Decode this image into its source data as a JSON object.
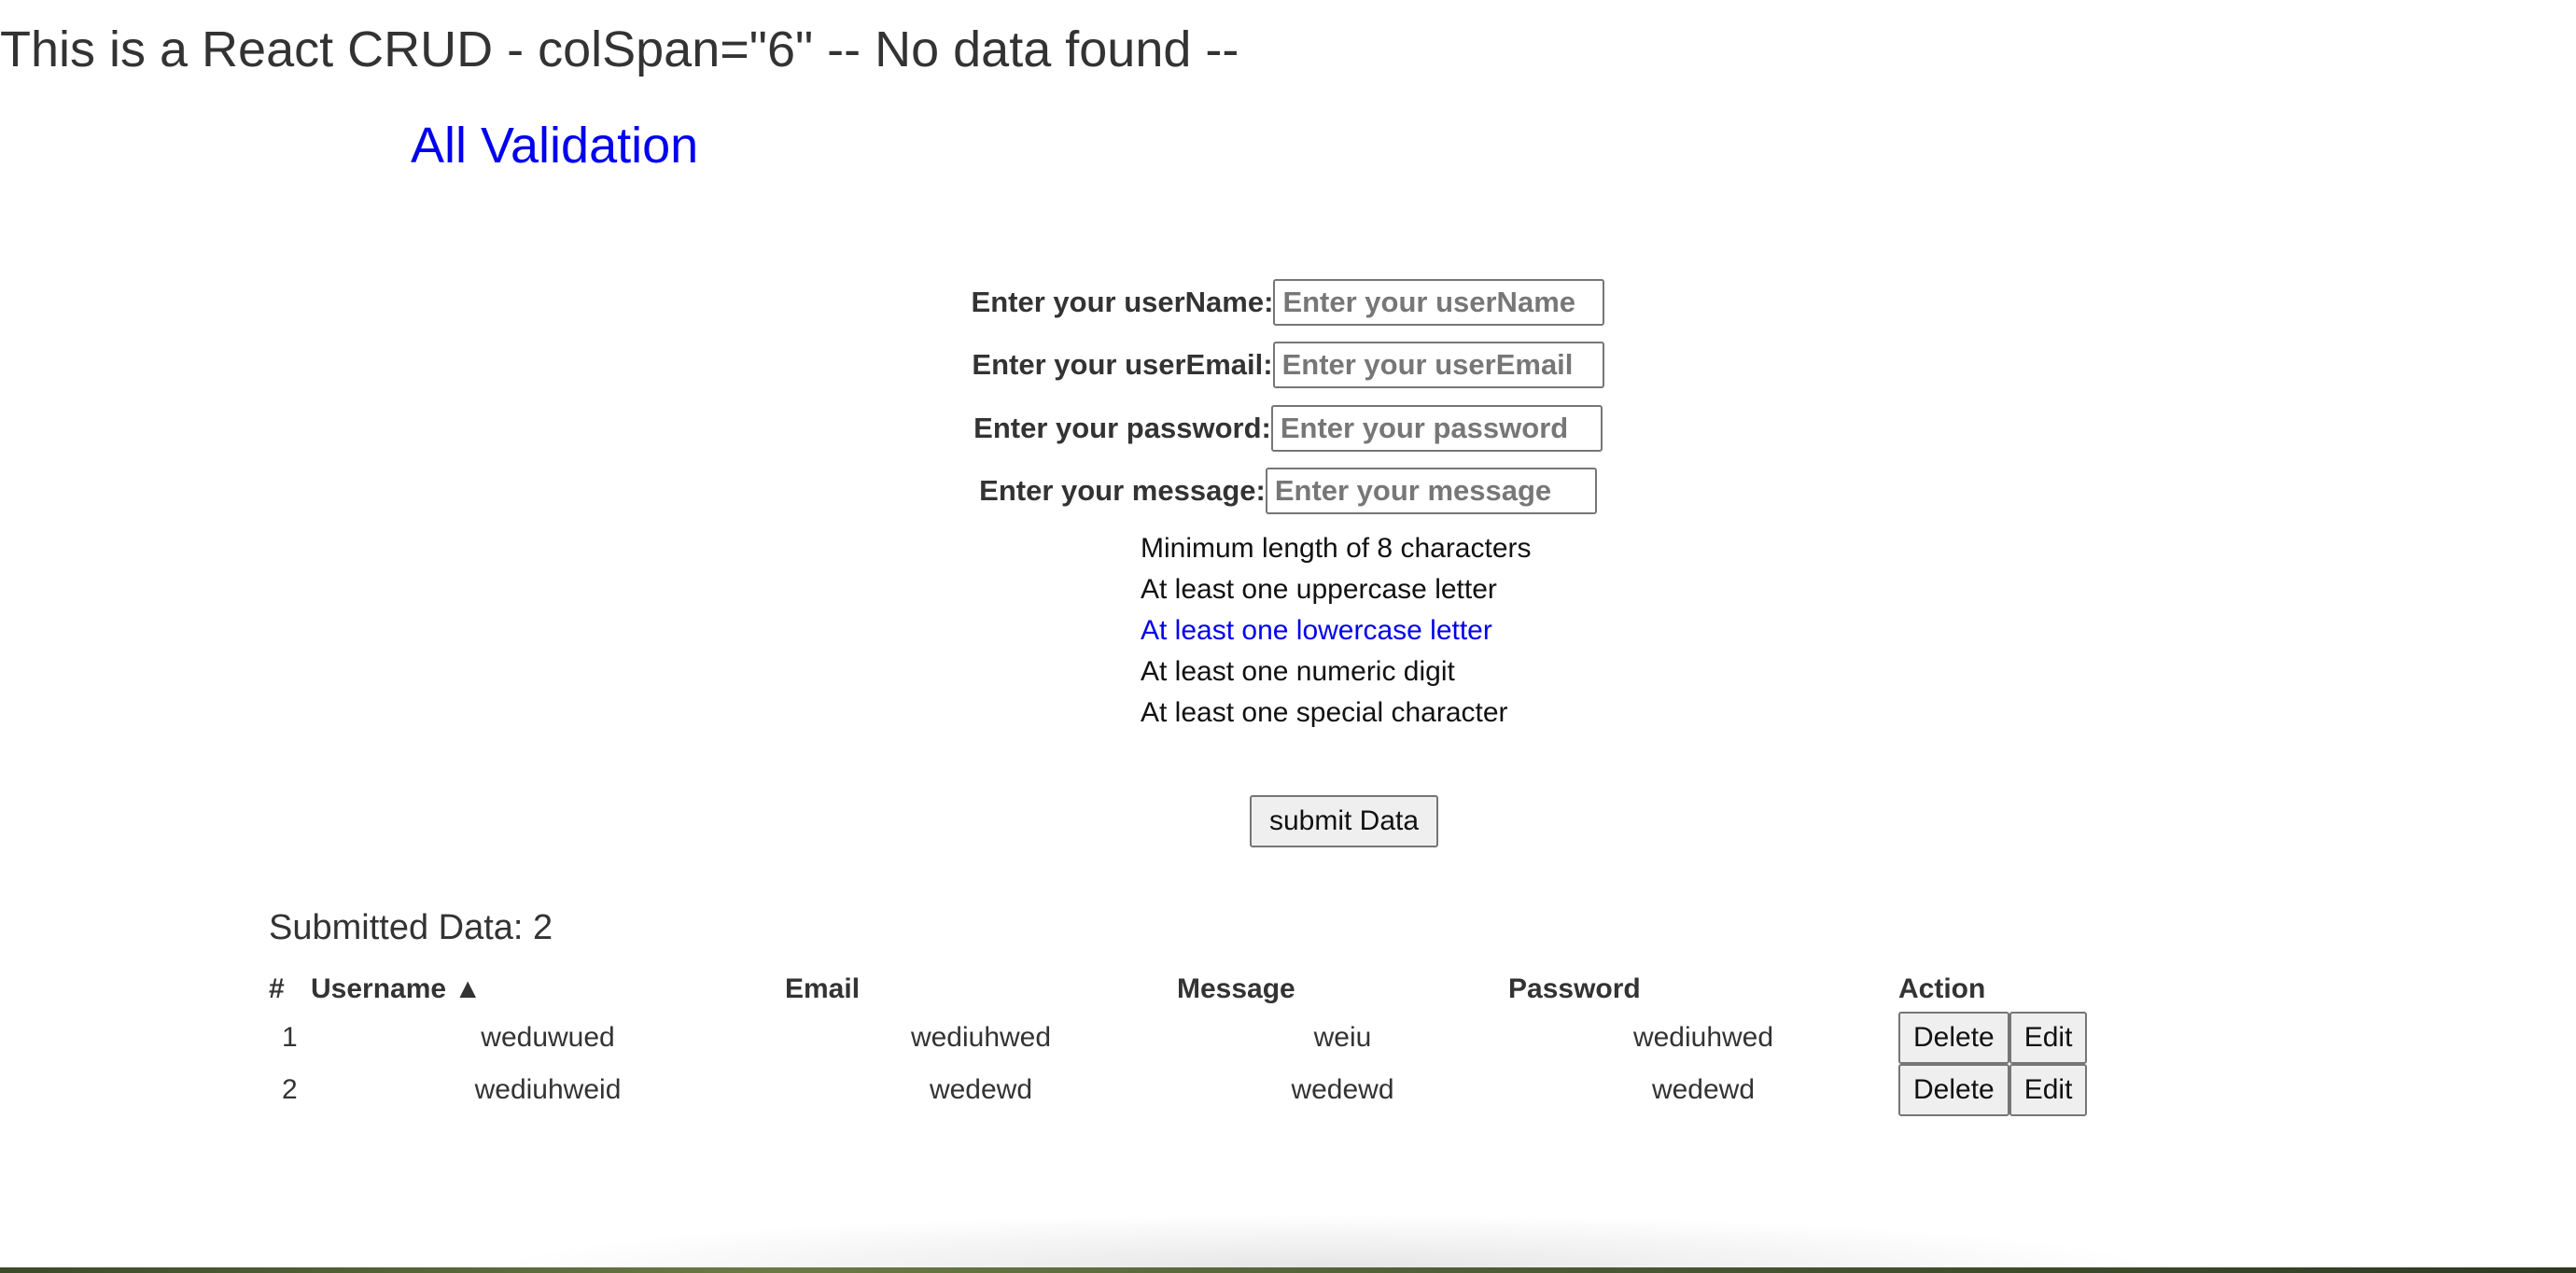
{
  "header": {
    "title": "This is a React CRUD - colSpan=\"6\" -- No data found --",
    "section_title": "All Validation"
  },
  "form": {
    "fields": [
      {
        "label": "Enter your userName:",
        "placeholder": "Enter your userName",
        "type": "text",
        "value": ""
      },
      {
        "label": "Enter your userEmail:",
        "placeholder": "Enter your userEmail",
        "type": "email",
        "value": ""
      },
      {
        "label": "Enter your password:",
        "placeholder": "Enter your password",
        "type": "password",
        "value": ""
      },
      {
        "label": "Enter your message:",
        "placeholder": "Enter your message",
        "type": "text",
        "value": ""
      }
    ],
    "password_rules": [
      {
        "text": "Minimum length of 8 characters",
        "met": false
      },
      {
        "text": "At least one uppercase letter",
        "met": false
      },
      {
        "text": "At least one lowercase letter",
        "met": true
      },
      {
        "text": "At least one numeric digit",
        "met": false
      },
      {
        "text": "At least one special character",
        "met": false
      }
    ],
    "submit_label": "submit Data"
  },
  "submitted": {
    "heading": "Submitted Data: 2",
    "columns": [
      "#",
      "Username ▲",
      "Email",
      "Message",
      "Password",
      "Action"
    ],
    "rows": [
      {
        "num": "1",
        "username": "weduwued",
        "email": "wediuhwed",
        "message": "weiu",
        "password": "wediuhwed"
      },
      {
        "num": "2",
        "username": "wediuhweid",
        "email": "wedewd",
        "message": "wedewd",
        "password": "wedewd"
      }
    ],
    "delete_label": "Delete",
    "edit_label": "Edit"
  },
  "colors": {
    "accent": "#0000ee",
    "text": "#333333",
    "button_bg": "#efefef"
  }
}
